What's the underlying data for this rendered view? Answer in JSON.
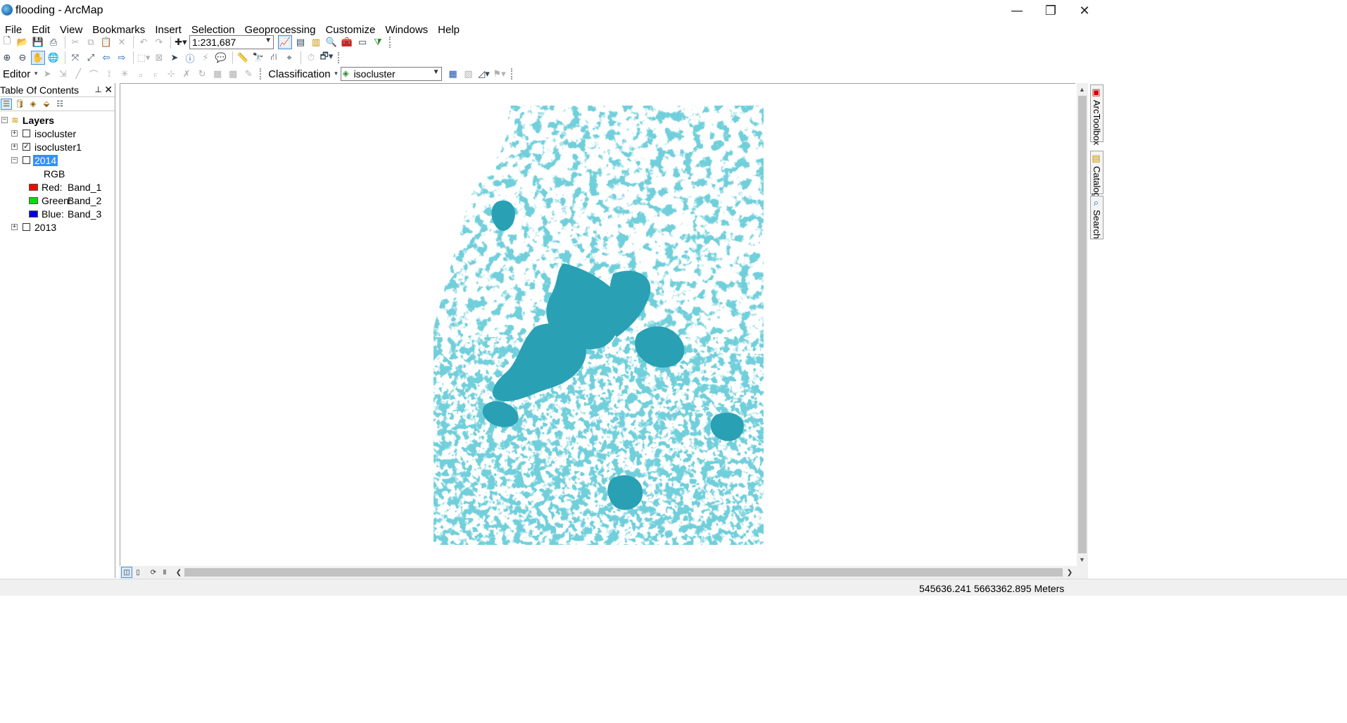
{
  "window": {
    "title": "flooding - ArcMap",
    "minimize_glyph": "—",
    "restore_glyph": "❐",
    "close_glyph": "✕"
  },
  "menu": [
    "File",
    "Edit",
    "View",
    "Bookmarks",
    "Insert",
    "Selection",
    "Geoprocessing",
    "Customize",
    "Windows",
    "Help"
  ],
  "standard_toolbar": {
    "scale_value": "1:231,687"
  },
  "editor_toolbar": {
    "editor_label": "Editor",
    "classification_label": "Classification",
    "layer_combo_value": "isocluster"
  },
  "toc": {
    "title": "Table Of Contents",
    "pin_glyph": "🖈",
    "close_glyph": "✕",
    "root_label": "Layers",
    "layers": [
      {
        "name": "isocluster",
        "checked": false,
        "expanded": false
      },
      {
        "name": "isocluster1",
        "checked": true,
        "expanded": false
      },
      {
        "name": "2014",
        "checked": false,
        "expanded": true,
        "selected": true
      },
      {
        "name": "2013",
        "checked": false,
        "expanded": false
      }
    ],
    "renderer_label": "RGB",
    "bands": [
      {
        "channel": "Red:",
        "band": "Band_1",
        "color": "#ff0000"
      },
      {
        "channel": "Green:",
        "band": "Band_2",
        "color": "#00e000"
      },
      {
        "channel": "Blue:",
        "band": "Band_3",
        "color": "#0000e0"
      }
    ]
  },
  "right_dock": [
    "ArcToolbox",
    "Catalog",
    "Search"
  ],
  "map": {
    "flood_color": "#2aa0b4",
    "background_color": "#ffffff"
  },
  "status": {
    "coordinates": "545636.241  5663362.895 Meters"
  },
  "icons": {
    "new": "new-document-icon",
    "open": "open-icon",
    "save": "save-icon",
    "print": "print-icon",
    "cut": "cut-icon",
    "copy": "copy-icon",
    "paste": "paste-icon",
    "delete": "delete-icon",
    "undo": "undo-icon",
    "redo": "redo-icon",
    "add_data": "add-data-icon"
  }
}
